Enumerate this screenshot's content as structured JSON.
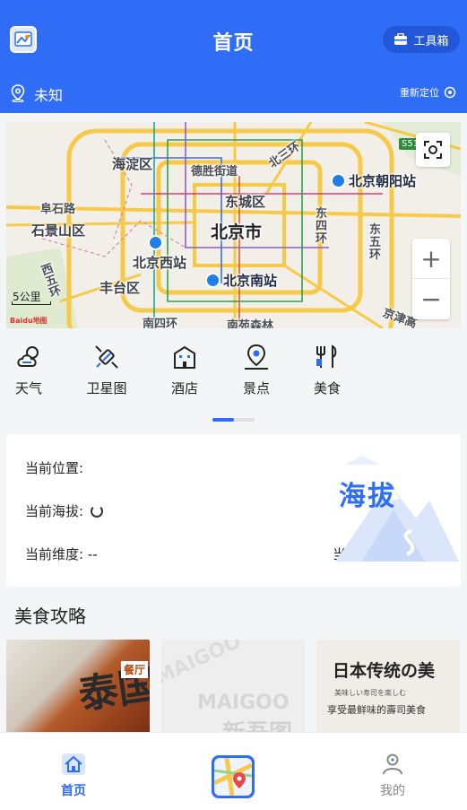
{
  "header": {
    "title": "首页",
    "toolbox_label": "工具箱",
    "location": "未知",
    "relocate_label": "重新定位"
  },
  "map": {
    "labels": {
      "haidian": "海淀区",
      "desheng": "德胜街道",
      "north3ring": "北三环",
      "chaoyang_station": "北京朝阳站",
      "fushi_road": "阜石路",
      "dongcheng": "东城区",
      "shijingshan": "石景山区",
      "beijing": "北京市",
      "east4ring": "东\n四\n环",
      "east5ring": "东\n五\n环",
      "west_station": "北京西站",
      "south_station": "北京南站",
      "west5ring": "西\n五\n环",
      "fengtai": "丰台区",
      "jingjin": "京津高",
      "south4ring": "南四环",
      "nanyuan": "南苑森林",
      "s51": "S51"
    },
    "scale_label": "5公里",
    "logo_text": "Baidu地图"
  },
  "quick_menu": [
    {
      "label": "天气",
      "icon": "weather-icon"
    },
    {
      "label": "卫星图",
      "icon": "satellite-icon"
    },
    {
      "label": "酒店",
      "icon": "hotel-icon"
    },
    {
      "label": "景点",
      "icon": "scenic-spot-icon"
    },
    {
      "label": "美食",
      "icon": "food-icon"
    }
  ],
  "altitude_card": {
    "position_label": "当前位置:",
    "altitude_label": "当前海拔:",
    "latitude_label": "当前维度:",
    "latitude_value": "--",
    "latitude2_label": "当前维度:",
    "latitude2_value": "--",
    "badge_text": "海拔"
  },
  "food": {
    "title": "美食攻略",
    "cards": [
      {
        "texts": [
          "泰国",
          "餐厅"
        ]
      },
      {
        "texts": [
          "MAIGOO",
          "MAIGOO",
          "新吾图"
        ]
      },
      {
        "texts": [
          "日本传统の美",
          "美味しい寿司を楽しむ",
          "享受最鲜味的壽司美食"
        ]
      }
    ]
  },
  "bottom_nav": {
    "home_label": "首页",
    "me_label": "我的"
  },
  "colors": {
    "primary": "#2f6df6",
    "text": "#222222",
    "inactive": "#888888"
  }
}
